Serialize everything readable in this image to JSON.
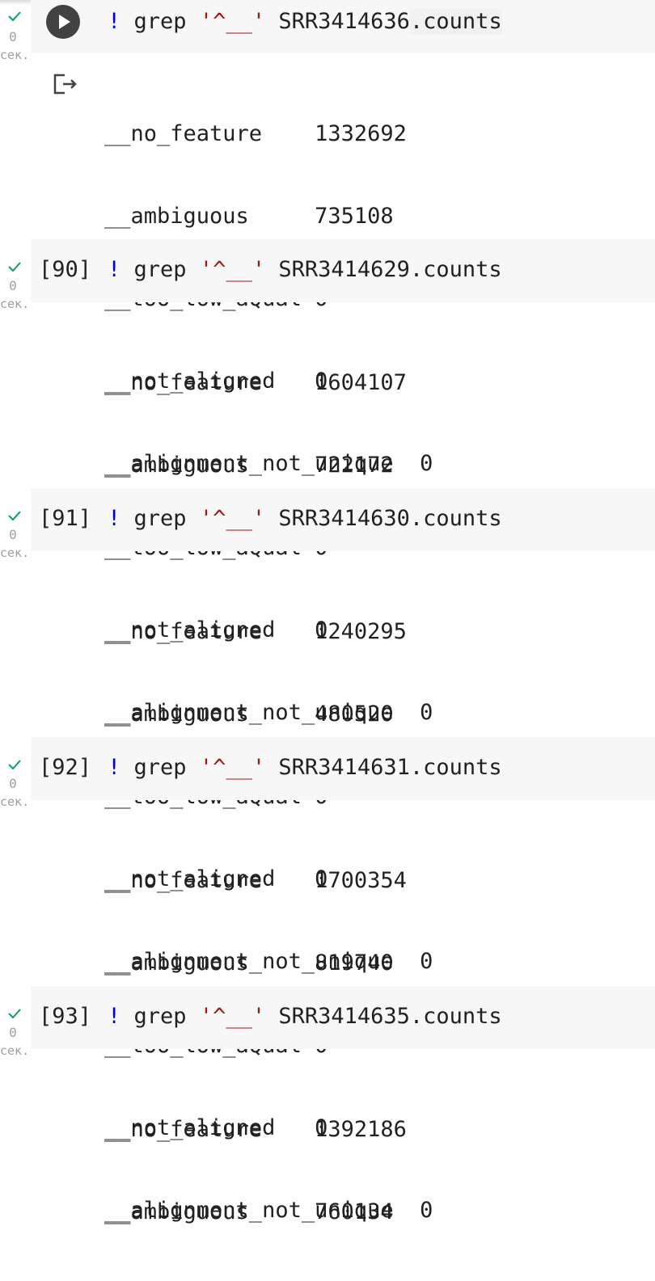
{
  "ui": {
    "time_unit": "сек."
  },
  "cells": [
    {
      "prompt": "",
      "exec_time": "0",
      "running_button": true,
      "code": {
        "bang": "!",
        "cmd": " grep ",
        "pattern": "'^__'",
        "file_pre": " SRR3414636",
        "file_hl": ".counts"
      },
      "output": [
        {
          "key": "__no_feature",
          "gap": "    ",
          "value": "1332692"
        },
        {
          "key": "__ambiguous",
          "gap": "     ",
          "value": "735108"
        },
        {
          "key": "__too_low_aQual",
          "gap": " ",
          "value": "0"
        },
        {
          "key": "__not_aligned",
          "gap": "   ",
          "value": "0"
        },
        {
          "key": "__alignment_not_unique",
          "gap": "  ",
          "value": "0"
        }
      ]
    },
    {
      "prompt": "[90]",
      "exec_time": "0",
      "code": {
        "bang": "!",
        "cmd": " grep ",
        "pattern": "'^__'",
        "file_pre": " SRR3414629.counts",
        "file_hl": ""
      },
      "output": [
        {
          "key": "__no_feature",
          "gap": "    ",
          "value": "1604107"
        },
        {
          "key": "__ambiguous",
          "gap": "     ",
          "value": "722172"
        },
        {
          "key": "__too_low_aQual",
          "gap": " ",
          "value": "0"
        },
        {
          "key": "__not_aligned",
          "gap": "   ",
          "value": "0"
        },
        {
          "key": "__alignment_not_unique",
          "gap": "  ",
          "value": "0"
        }
      ]
    },
    {
      "prompt": "[91]",
      "exec_time": "0",
      "code": {
        "bang": "!",
        "cmd": " grep ",
        "pattern": "'^__'",
        "file_pre": " SRR3414630.counts",
        "file_hl": ""
      },
      "output": [
        {
          "key": "__no_feature",
          "gap": "    ",
          "value": "1240295"
        },
        {
          "key": "__ambiguous",
          "gap": "     ",
          "value": "480520"
        },
        {
          "key": "__too_low_aQual",
          "gap": " ",
          "value": "0"
        },
        {
          "key": "__not_aligned",
          "gap": "   ",
          "value": "0"
        },
        {
          "key": "__alignment_not_unique",
          "gap": "  ",
          "value": "0"
        }
      ]
    },
    {
      "prompt": "[92]",
      "exec_time": "0",
      "code": {
        "bang": "!",
        "cmd": " grep ",
        "pattern": "'^__'",
        "file_pre": " SRR3414631.counts",
        "file_hl": ""
      },
      "output": [
        {
          "key": "__no_feature",
          "gap": "    ",
          "value": "1700354"
        },
        {
          "key": "__ambiguous",
          "gap": "     ",
          "value": "819740"
        },
        {
          "key": "__too_low_aQual",
          "gap": " ",
          "value": "0"
        },
        {
          "key": "__not_aligned",
          "gap": "   ",
          "value": "0"
        },
        {
          "key": "__alignment_not_unique",
          "gap": "  ",
          "value": "0"
        }
      ]
    },
    {
      "prompt": "[93]",
      "exec_time": "0",
      "code": {
        "bang": "!",
        "cmd": " grep ",
        "pattern": "'^__'",
        "file_pre": " SRR3414635.counts",
        "file_hl": ""
      },
      "output": [
        {
          "key": "__no_feature",
          "gap": "    ",
          "value": "1392186"
        },
        {
          "key": "__ambiguous",
          "gap": "     ",
          "value": "760134"
        }
      ]
    }
  ]
}
